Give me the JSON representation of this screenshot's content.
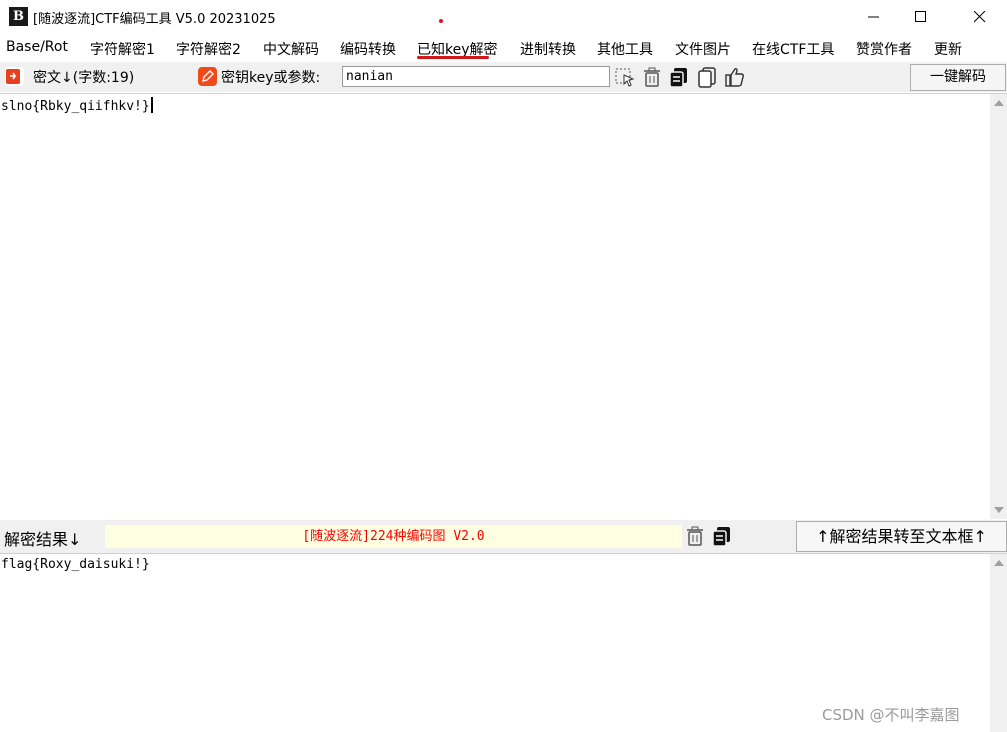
{
  "window": {
    "title": "[随波逐流]CTF编码工具 V5.0 20231025",
    "app_icon_text": "B",
    "controls": [
      "minimize-icon",
      "maximize-icon",
      "close-icon"
    ]
  },
  "menu": {
    "items": [
      "Base/Rot",
      "字符解密1",
      "字符解密2",
      "中文解码",
      "编码转换",
      "已知key解密",
      "进制转换",
      "其他工具",
      "文件图片",
      "在线CTF工具",
      "赞赏作者",
      "更新"
    ],
    "active": "已知key解密",
    "underline_color": "#d01818"
  },
  "toolbar": {
    "cipher_label": "密文↓(字数:19)",
    "key_label": "密钥key或参数:",
    "key_value": "nanian",
    "decode_all_label": "一键解码",
    "icons": [
      "import-icon",
      "pen-icon",
      "select-icon",
      "trash-icon",
      "copy-icon",
      "paste-icon",
      "thumbs-up-icon"
    ]
  },
  "input": {
    "text": "slno{Rbky_qiifhkv!}"
  },
  "result_bar": {
    "label": "解密结果↓",
    "banner": "[随波逐流]224种编码图 V2.0",
    "transfer_label": "↑解密结果转至文本框↑"
  },
  "output": {
    "text": "flag{Roxy_daisuki!}"
  },
  "watermark": "CSDN @不叫李嘉图",
  "colors": {
    "banner_bg": "#ffffe1",
    "banner_text": "#ff0000",
    "toolbar_bg": "#f0f0f0",
    "accent_red": "#e8401c"
  }
}
